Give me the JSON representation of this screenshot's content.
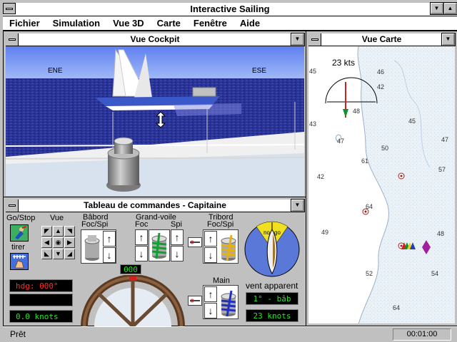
{
  "app": {
    "title": "Interactive Sailing"
  },
  "menu": [
    {
      "label": "Fichier"
    },
    {
      "label": "Simulation"
    },
    {
      "label": "Vue 3D"
    },
    {
      "label": "Carte"
    },
    {
      "label": "Fenêtre"
    },
    {
      "label": "Aide"
    }
  ],
  "cockpit": {
    "title": "Vue Cockpit",
    "heading_left": "ENE",
    "heading_right": "ESE"
  },
  "panel": {
    "title": "Tableau de commandes  - Capitaine",
    "go_stop": "Go/Stop",
    "vue": "Vue",
    "tirer": "tirer",
    "babord": "Bâbord",
    "babord_sub": "Foc/Spi",
    "grand_voile": "Grand-voile",
    "gv_foc": "Foc",
    "gv_spi": "Spi",
    "tribord": "Tribord",
    "tribord_sub": "Foc/Spi",
    "main": "Main",
    "heading": "hdg:  000°",
    "speed": "0.0  knots",
    "rudder": "000",
    "wind_label": "vent apparent",
    "wind_angle": "1° - bâb",
    "wind_speed": "23  knots",
    "wind_no": "no",
    "wind_go": "go"
  },
  "chart": {
    "title": "Vue Carte",
    "wind_speed": "23 kts",
    "depths": [
      "45",
      "46",
      "42",
      "48",
      "45",
      "43",
      "47",
      "47",
      "50",
      "61",
      "42",
      "57",
      "64",
      "49",
      "48",
      "54",
      "52",
      "64"
    ]
  },
  "status": {
    "text": "Prêt",
    "time": "00:01:00"
  },
  "colors": {
    "sky": "#7090f0",
    "sea": "#283098",
    "lcd_green": "#22e822",
    "lcd_red": "#ff2a2a"
  }
}
